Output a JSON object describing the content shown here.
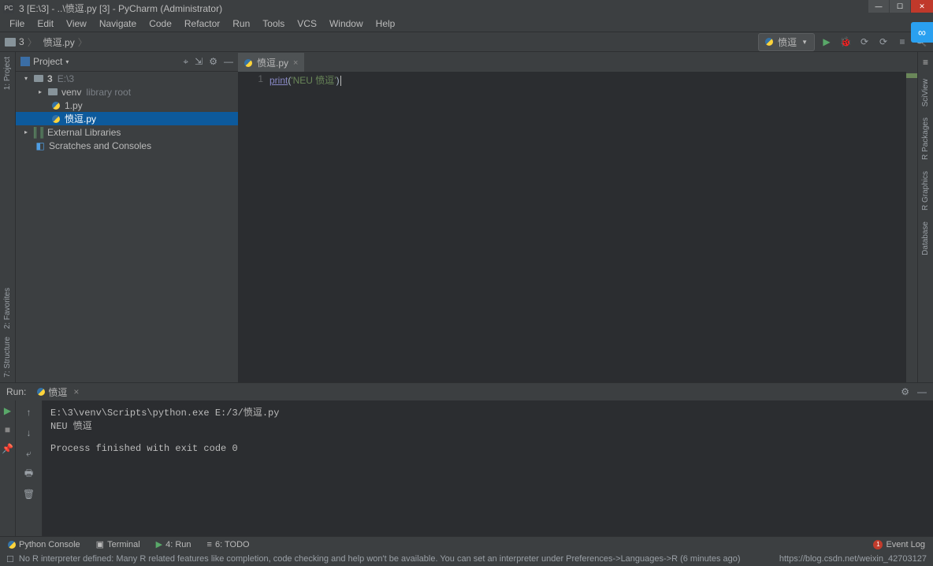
{
  "title": "3 [E:\\3] - ..\\愤逗.py [3] - PyCharm (Administrator)",
  "menus": [
    "File",
    "Edit",
    "View",
    "Navigate",
    "Code",
    "Refactor",
    "Run",
    "Tools",
    "VCS",
    "Window",
    "Help"
  ],
  "breadcrumb": {
    "root": "3",
    "file": "愤逗.py"
  },
  "runcfg_label": "愤逗",
  "toolbar_right": {
    "play": "▶",
    "bug": "🐞",
    "restart": "⟳",
    "stop": "⟳",
    "cfg": "≡",
    "search": "🔍"
  },
  "project_panel": {
    "title": "Project",
    "root": {
      "label": "3",
      "path": "E:\\3"
    },
    "items": [
      {
        "label": "venv",
        "suffix": "library root",
        "kind": "folder"
      },
      {
        "label": "1.py",
        "kind": "py"
      },
      {
        "label": "愤逗.py",
        "kind": "py",
        "selected": true
      }
    ],
    "ext_lib": "External Libraries",
    "scratches": "Scratches and Consoles"
  },
  "tabs": [
    {
      "label": "愤逗.py"
    }
  ],
  "code": {
    "line": "1",
    "fn": "print",
    "open": "(",
    "str": "'NEU 愤逗'",
    "close": ")"
  },
  "run_panel": {
    "title": "Run:",
    "tab": "愤逗",
    "output": "E:\\3\\venv\\Scripts\\python.exe E:/3/愤逗.py\nNEU 愤逗\n\nProcess finished with exit code 0"
  },
  "bottom_tabs": {
    "pyconsole": "Python Console",
    "terminal": "Terminal",
    "run": "4: Run",
    "todo": "6: TODO",
    "eventlog": "Event Log",
    "evt_count": "1"
  },
  "right_labels": [
    "SciView",
    "R Packages",
    "R Graphics",
    "Database"
  ],
  "left_labels": [
    "1: Project",
    "2: Favorites",
    "7: Structure"
  ],
  "status": {
    "msg": "No R interpreter defined: Many R related features like completion, code checking and help won't be available. You can set an interpreter under Preferences->Languages->R (6 minutes ago)",
    "wm": "https://blog.csdn.net/weixin_42703127"
  }
}
